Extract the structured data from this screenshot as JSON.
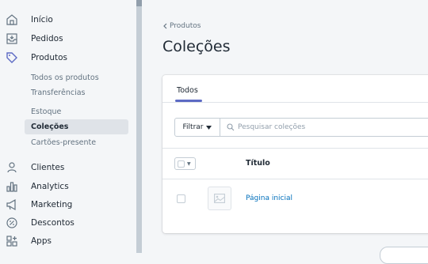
{
  "sidebar": {
    "items": [
      {
        "label": "Início",
        "icon": "home-icon"
      },
      {
        "label": "Pedidos",
        "icon": "orders-icon"
      },
      {
        "label": "Produtos",
        "icon": "tag-icon"
      }
    ],
    "product_subitems": [
      {
        "label": "Todos os produtos"
      },
      {
        "label": "Transferências"
      },
      {
        "label": "Estoque"
      },
      {
        "label": "Coleções",
        "active": true
      },
      {
        "label": "Cartões-presente"
      }
    ],
    "lower_items": [
      {
        "label": "Clientes",
        "icon": "person-icon"
      },
      {
        "label": "Analytics",
        "icon": "bar-chart-icon"
      },
      {
        "label": "Marketing",
        "icon": "megaphone-icon"
      },
      {
        "label": "Descontos",
        "icon": "discount-icon"
      },
      {
        "label": "Apps",
        "icon": "apps-icon"
      }
    ]
  },
  "main": {
    "breadcrumb": "Produtos",
    "title": "Coleções",
    "tabs": [
      {
        "label": "Todos",
        "active": true
      }
    ],
    "filter_label": "Filtrar",
    "search_placeholder": "Pesquisar coleções",
    "table": {
      "columns": [
        "Título"
      ],
      "rows": [
        {
          "title": "Página inicial"
        }
      ]
    }
  },
  "colors": {
    "accent": "#5c6ac4",
    "link": "#006fbb",
    "sidebar_active_bg": "#dfe3e8"
  }
}
